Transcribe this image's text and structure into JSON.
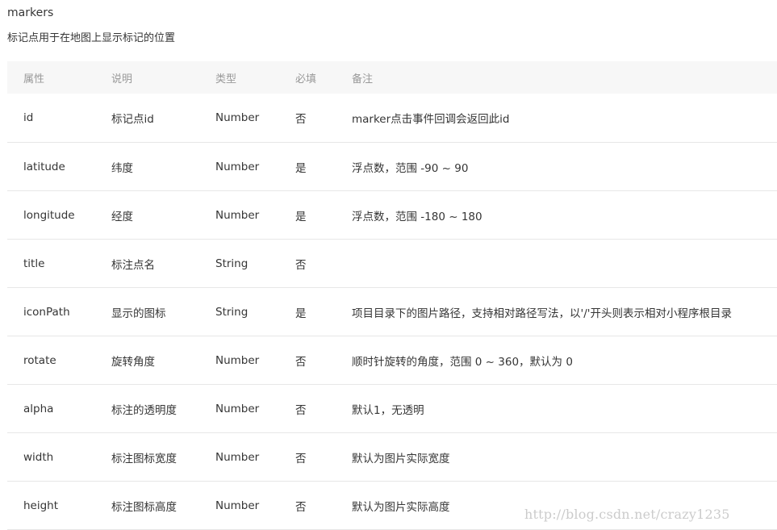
{
  "section_title": "markers",
  "section_desc": "标记点用于在地图上显示标记的位置",
  "table": {
    "headers": [
      "属性",
      "说明",
      "类型",
      "必填",
      "备注"
    ],
    "rows": [
      [
        "id",
        "标记点id",
        "Number",
        "否",
        "marker点击事件回调会返回此id"
      ],
      [
        "latitude",
        "纬度",
        "Number",
        "是",
        "浮点数，范围 -90 ~ 90"
      ],
      [
        "longitude",
        "经度",
        "Number",
        "是",
        "浮点数，范围 -180 ~ 180"
      ],
      [
        "title",
        "标注点名",
        "String",
        "否",
        ""
      ],
      [
        "iconPath",
        "显示的图标",
        "String",
        "是",
        "项目目录下的图片路径，支持相对路径写法，以'/'开头则表示相对小程序根目录"
      ],
      [
        "rotate",
        "旋转角度",
        "Number",
        "否",
        "顺时针旋转的角度，范围 0 ~ 360，默认为 0"
      ],
      [
        "alpha",
        "标注的透明度",
        "Number",
        "否",
        "默认1，无透明"
      ],
      [
        "width",
        "标注图标宽度",
        "Number",
        "否",
        "默认为图片实际宽度"
      ],
      [
        "height",
        "标注图标高度",
        "Number",
        "否",
        "默认为图片实际高度"
      ]
    ]
  },
  "watermark": "http://blog.csdn.net/crazy1235"
}
